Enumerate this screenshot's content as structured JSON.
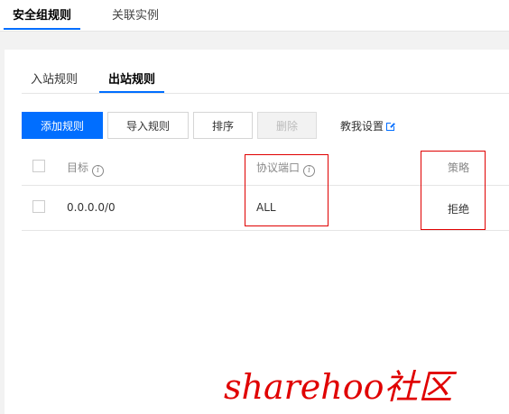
{
  "top_tabs": [
    {
      "label": "安全组规则",
      "active": true
    },
    {
      "label": "关联实例",
      "active": false
    }
  ],
  "rule_tabs": [
    {
      "label": "入站规则",
      "active": false
    },
    {
      "label": "出站规则",
      "active": true
    }
  ],
  "toolbar": {
    "add_label": "添加规则",
    "import_label": "导入规则",
    "sort_label": "排序",
    "delete_label": "删除",
    "help_label": "教我设置"
  },
  "table": {
    "columns": [
      "目标",
      "协议端口",
      "策略"
    ],
    "rows": [
      {
        "target": "0.0.0.0/0",
        "port": "ALL",
        "policy": "拒绝"
      }
    ]
  },
  "watermark": "sharehoo社区",
  "colors": {
    "accent": "#006eff",
    "highlight": "#e00000"
  },
  "icons": {
    "info": "info-icon",
    "external_link": "external-link-icon",
    "checkbox": "checkbox"
  }
}
